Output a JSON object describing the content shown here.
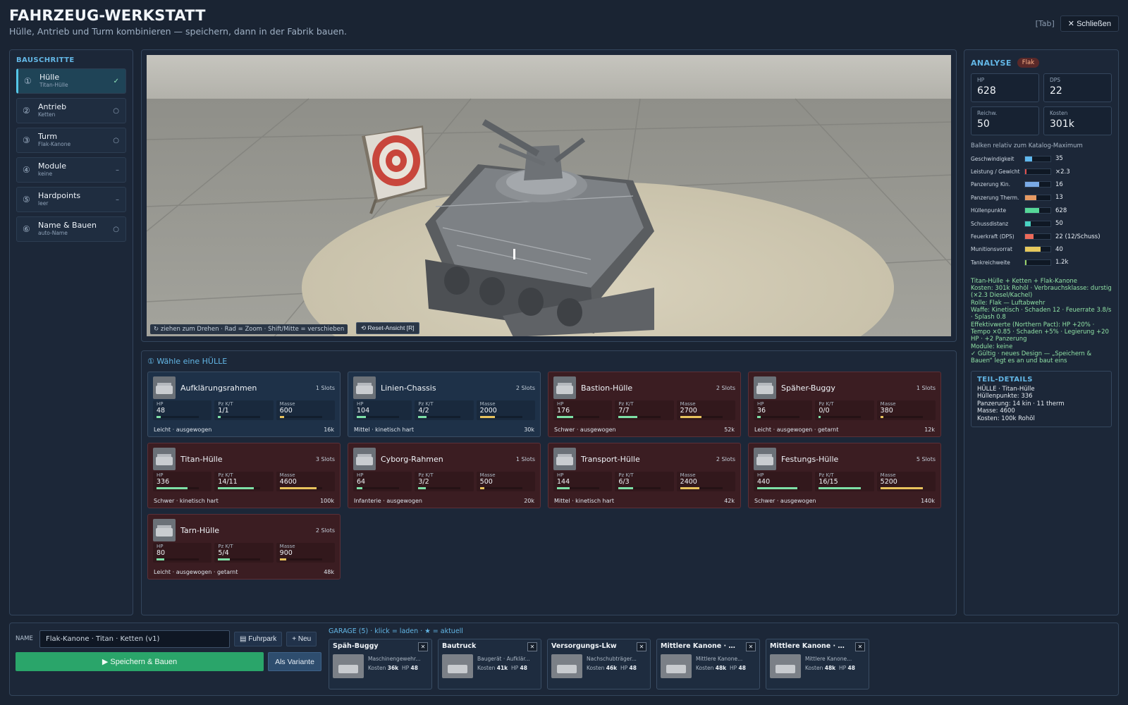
{
  "header": {
    "title": "FAHRZEUG-WERKSTATT",
    "subtitle": "Hülle, Antrieb und Turm kombinieren — speichern, dann in der Fabrik bauen.",
    "tab_hint": "[Tab]",
    "close_label": "Schließen",
    "close_icon": "✕"
  },
  "steps": {
    "title": "BAUSCHRITTE",
    "items": [
      {
        "num": "①",
        "label": "Hülle",
        "sub": "Titan-Hülle",
        "status": "✓"
      },
      {
        "num": "②",
        "label": "Antrieb",
        "sub": "Ketten",
        "status": "○"
      },
      {
        "num": "③",
        "label": "Turm",
        "sub": "Flak-Kanone",
        "status": "○"
      },
      {
        "num": "④",
        "label": "Module",
        "sub": "keine",
        "status": "–"
      },
      {
        "num": "⑤",
        "label": "Hardpoints",
        "sub": "leer",
        "status": "–"
      },
      {
        "num": "⑥",
        "label": "Name & Bauen",
        "sub": "auto-Name",
        "status": "○"
      }
    ]
  },
  "viewport": {
    "hint": "↻ ziehen zum Drehen · Rad = Zoom · Shift/Mitte = verschieben",
    "reset_label": "⟲ Reset-Ansicht [R]"
  },
  "parts": {
    "title": "① Wähle eine HÜLLE",
    "stat_labels": [
      "HP",
      "Pz K/T",
      "Masse"
    ],
    "items": [
      {
        "name": "Aufklärungsrahmen",
        "slots": "1 Slots",
        "hp": "48",
        "pz": "1/1",
        "mass": "600",
        "tags": "Leicht · ausgewogen",
        "cost": "16k",
        "hp_f": 0.1,
        "pz_f": 0.06,
        "mass_f": 0.1,
        "red": false
      },
      {
        "name": "Linien-Chassis",
        "slots": "2 Slots",
        "hp": "104",
        "pz": "4/2",
        "mass": "2000",
        "tags": "Mittel · kinetisch hart",
        "cost": "30k",
        "hp_f": 0.22,
        "pz_f": 0.2,
        "mass_f": 0.35,
        "red": false
      },
      {
        "name": "Bastion-Hülle",
        "slots": "2 Slots",
        "hp": "176",
        "pz": "7/7",
        "mass": "2700",
        "tags": "Schwer · ausgewogen",
        "cost": "52k",
        "hp_f": 0.38,
        "pz_f": 0.45,
        "mass_f": 0.5,
        "red": true
      },
      {
        "name": "Späher-Buggy",
        "slots": "1 Slots",
        "hp": "36",
        "pz": "0/0",
        "mass": "380",
        "tags": "Leicht · ausgewogen · getarnt",
        "cost": "12k",
        "hp_f": 0.08,
        "pz_f": 0.04,
        "mass_f": 0.08,
        "red": true
      },
      {
        "name": "Titan-Hülle",
        "slots": "3 Slots",
        "hp": "336",
        "pz": "14/11",
        "mass": "4600",
        "tags": "Schwer · kinetisch hart",
        "cost": "100k",
        "hp_f": 0.74,
        "pz_f": 0.85,
        "mass_f": 0.88,
        "red": true
      },
      {
        "name": "Cyborg-Rahmen",
        "slots": "1 Slots",
        "hp": "64",
        "pz": "3/2",
        "mass": "500",
        "tags": "Infanterie · ausgewogen",
        "cost": "20k",
        "hp_f": 0.14,
        "pz_f": 0.18,
        "mass_f": 0.1,
        "red": true
      },
      {
        "name": "Transport-Hülle",
        "slots": "2 Slots",
        "hp": "144",
        "pz": "6/3",
        "mass": "2400",
        "tags": "Mittel · kinetisch hart",
        "cost": "42k",
        "hp_f": 0.3,
        "pz_f": 0.35,
        "mass_f": 0.45,
        "red": true
      },
      {
        "name": "Festungs-Hülle",
        "slots": "5 Slots",
        "hp": "440",
        "pz": "16/15",
        "mass": "5200",
        "tags": "Schwer · ausgewogen",
        "cost": "140k",
        "hp_f": 0.95,
        "pz_f": 1.0,
        "mass_f": 1.0,
        "red": true
      },
      {
        "name": "Tarn-Hülle",
        "slots": "2 Slots",
        "hp": "80",
        "pz": "5/4",
        "mass": "900",
        "tags": "Leicht · ausgewogen · getarnt",
        "cost": "48k",
        "hp_f": 0.18,
        "pz_f": 0.28,
        "mass_f": 0.16,
        "red": true
      }
    ]
  },
  "analysis": {
    "title": "ANALYSE",
    "badge": "Flak",
    "kpis": [
      {
        "label": "HP",
        "value": "628"
      },
      {
        "label": "DPS",
        "value": "22"
      },
      {
        "label": "Reichw.",
        "value": "50"
      },
      {
        "label": "Kosten",
        "value": "301k"
      }
    ],
    "bar_note": "Balken relativ zum Katalog-Maximum",
    "bars": [
      {
        "label": "Geschwindigkeit",
        "value": "35",
        "fill": 0.28,
        "color": "#5fb8ee"
      },
      {
        "label": "Leistung / Gewicht",
        "value": "×2.3",
        "fill": 0.06,
        "color": "#e0504e"
      },
      {
        "label": "Panzerung Kin.",
        "value": "16",
        "fill": 0.55,
        "color": "#7aaae6"
      },
      {
        "label": "Panzerung Therm.",
        "value": "13",
        "fill": 0.45,
        "color": "#e59a63"
      },
      {
        "label": "Hüllenpunkte",
        "value": "628",
        "fill": 0.55,
        "color": "#56d898"
      },
      {
        "label": "Schussdistanz",
        "value": "50",
        "fill": 0.22,
        "color": "#49d2c2"
      },
      {
        "label": "Feuerkraft (DPS)",
        "value": "22 (12/Schuss)",
        "fill": 0.32,
        "color": "#ec6a5a"
      },
      {
        "label": "Munitionsvorrat",
        "value": "40",
        "fill": 0.62,
        "color": "#e6c85c"
      },
      {
        "label": "Tankreichweite",
        "value": "1.2k",
        "fill": 0.05,
        "color": "#9ad36a"
      }
    ],
    "summary": [
      "Titan-Hülle + Ketten + Flak-Kanone",
      "Kosten: 301k Rohöl · Verbrauchsklasse: durstig (×2.3 Diesel/Kachel)",
      "Rolle: Flak — Luftabwehr",
      "Waffe: Kinetisch · Schaden 12 · Feuerrate 3.8/s · Splash 0.8",
      "Effektivwerte (Northern Pact): HP +20% · Tempo ×0.85 · Schaden +5% · Legierung +20 HP · +2 Panzerung",
      "Module: keine",
      "✓ Gültig · neues Design — „Speichern & Bauen“ legt es an und baut eins"
    ],
    "details_title": "TEIL-DETAILS",
    "details": [
      "HÜLLE · Titan-Hülle",
      "Hüllenpunkte: 336",
      "Panzerung: 14 kin · 11 therm",
      "Masse: 4600",
      "Kosten: 100k Rohöl"
    ]
  },
  "bottom": {
    "name_label": "NAME",
    "name_value": "Flak-Kanone · Titan · Ketten (v1)",
    "fuhrpark_label": "▤ Fuhrpark",
    "new_label": "+ Neu",
    "save_label": "▶ Speichern & Bauen",
    "variant_label": "Als Variante",
    "garage_title": "GARAGE (5) · klick = laden · ★ = aktuell",
    "garage": [
      {
        "name": "Späh-Buggy",
        "desc": "Maschinengewehr...",
        "cost": "36k",
        "hp": "48"
      },
      {
        "name": "Bautruck",
        "desc": "Baugerät · Aufklär...",
        "cost": "41k",
        "hp": "48"
      },
      {
        "name": "Versorgungs-Lkw",
        "desc": "Nachschubträger...",
        "cost": "46k",
        "hp": "48"
      },
      {
        "name": "Mittlere Kanone · Auf...",
        "desc": "Mittlere Kanone...",
        "cost": "48k",
        "hp": "48"
      },
      {
        "name": "Mittlere Kanone · Auf...",
        "desc": "Mittlere Kanone...",
        "cost": "48k",
        "hp": "48"
      }
    ],
    "cost_label": "Kosten",
    "hp_label": "HP",
    "remove_icon": "✕"
  }
}
